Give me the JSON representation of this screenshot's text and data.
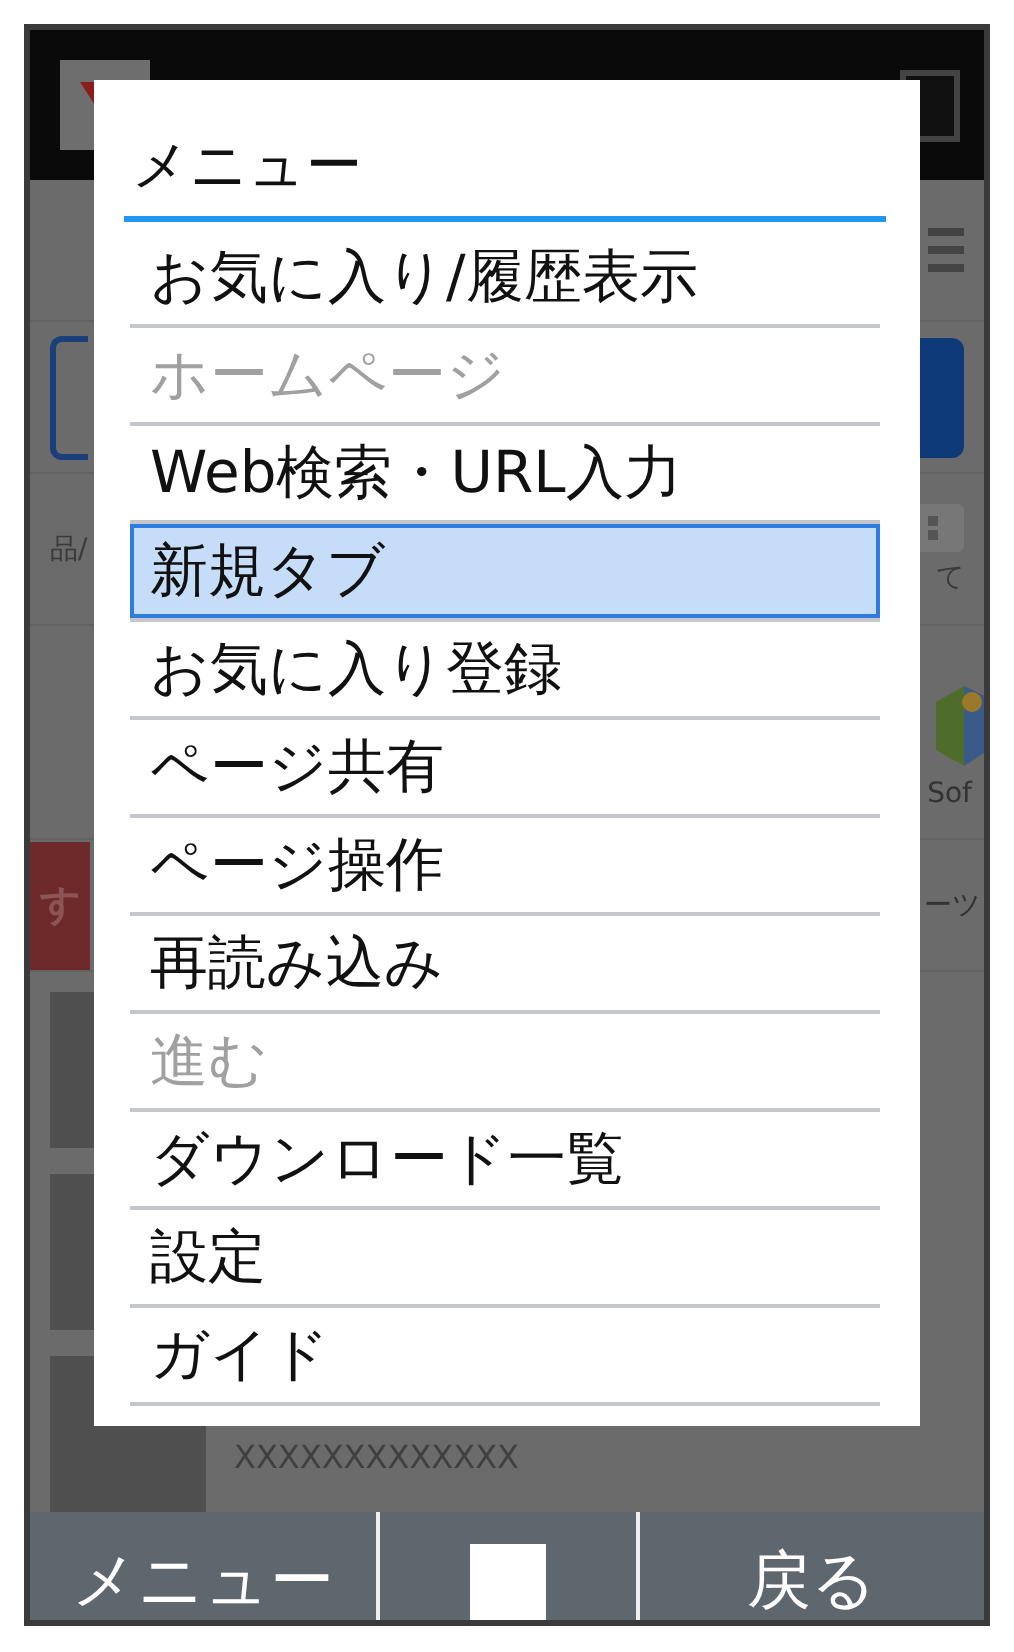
{
  "background": {
    "hint_text": "品/",
    "side_text": "て",
    "app_label": "Sof",
    "banner_text": "す",
    "tab_text": "ーツ",
    "caption": "XXXXXXXXXXXXX"
  },
  "menu": {
    "title": "メニュー",
    "items": [
      {
        "label": "お気に入り/履歴表示",
        "selected": false,
        "disabled": false
      },
      {
        "label": "ホームページ",
        "selected": false,
        "disabled": true
      },
      {
        "label": "Web検索・URL入力",
        "selected": false,
        "disabled": false
      },
      {
        "label": "新規タブ",
        "selected": true,
        "disabled": false
      },
      {
        "label": "お気に入り登録",
        "selected": false,
        "disabled": false
      },
      {
        "label": "ページ共有",
        "selected": false,
        "disabled": false
      },
      {
        "label": "ページ操作",
        "selected": false,
        "disabled": false
      },
      {
        "label": "再読み込み",
        "selected": false,
        "disabled": false
      },
      {
        "label": "進む",
        "selected": false,
        "disabled": true
      },
      {
        "label": "ダウンロード一覧",
        "selected": false,
        "disabled": false
      },
      {
        "label": "設定",
        "selected": false,
        "disabled": false
      },
      {
        "label": "ガイド",
        "selected": false,
        "disabled": false
      }
    ]
  },
  "softkeys": {
    "left": "メニュー",
    "right": "戻る"
  }
}
